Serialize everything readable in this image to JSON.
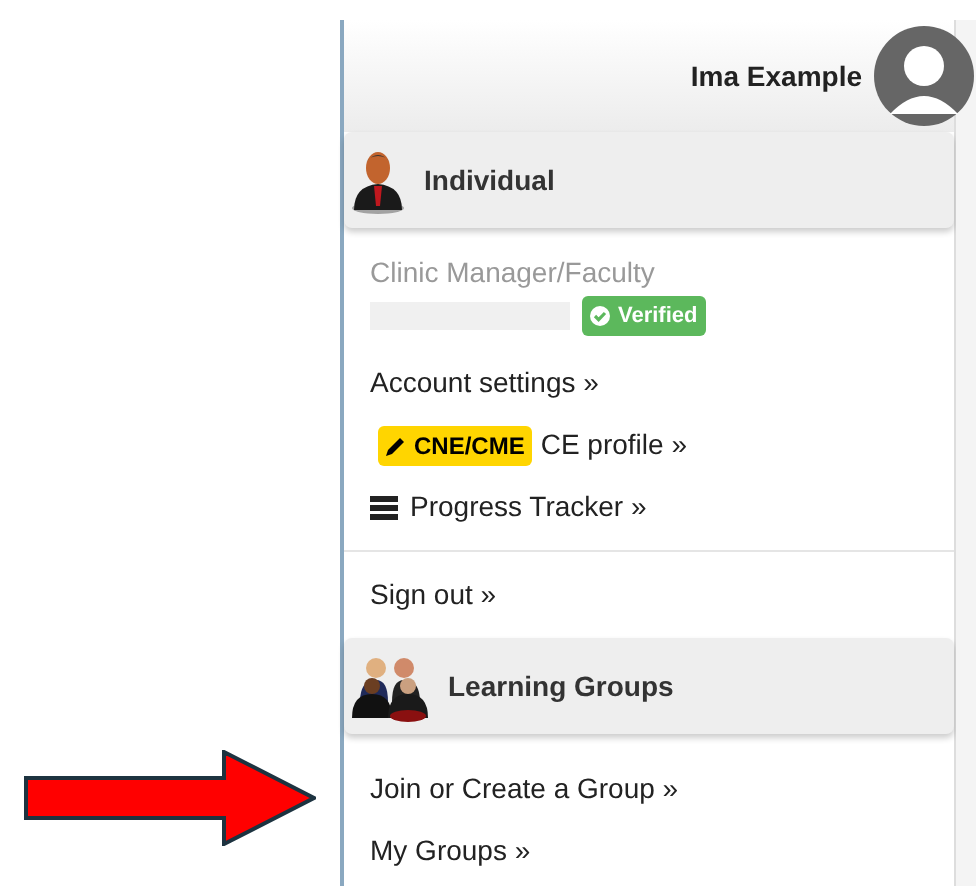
{
  "header": {
    "user_name": "Ima Example"
  },
  "sections": [
    {
      "title": "Individual",
      "kind": "person",
      "role": "Clinic Manager/Faculty",
      "badge": "Verified",
      "links": [
        {
          "kind": "plain",
          "text": "Account settings »"
        },
        {
          "kind": "tag",
          "tag": "CNE/CME",
          "text": "CE profile »"
        },
        {
          "kind": "tracker",
          "text": "Progress Tracker »"
        }
      ],
      "after_links": [
        {
          "kind": "plain",
          "text": "Sign out »"
        }
      ]
    },
    {
      "title": "Learning Groups",
      "kind": "group",
      "links": [
        {
          "kind": "plain",
          "text": "Join or Create a Group »"
        },
        {
          "kind": "plain",
          "text": "My Groups »"
        }
      ]
    }
  ],
  "annotation": {
    "kind": "arrow",
    "color": "#ff0000"
  }
}
